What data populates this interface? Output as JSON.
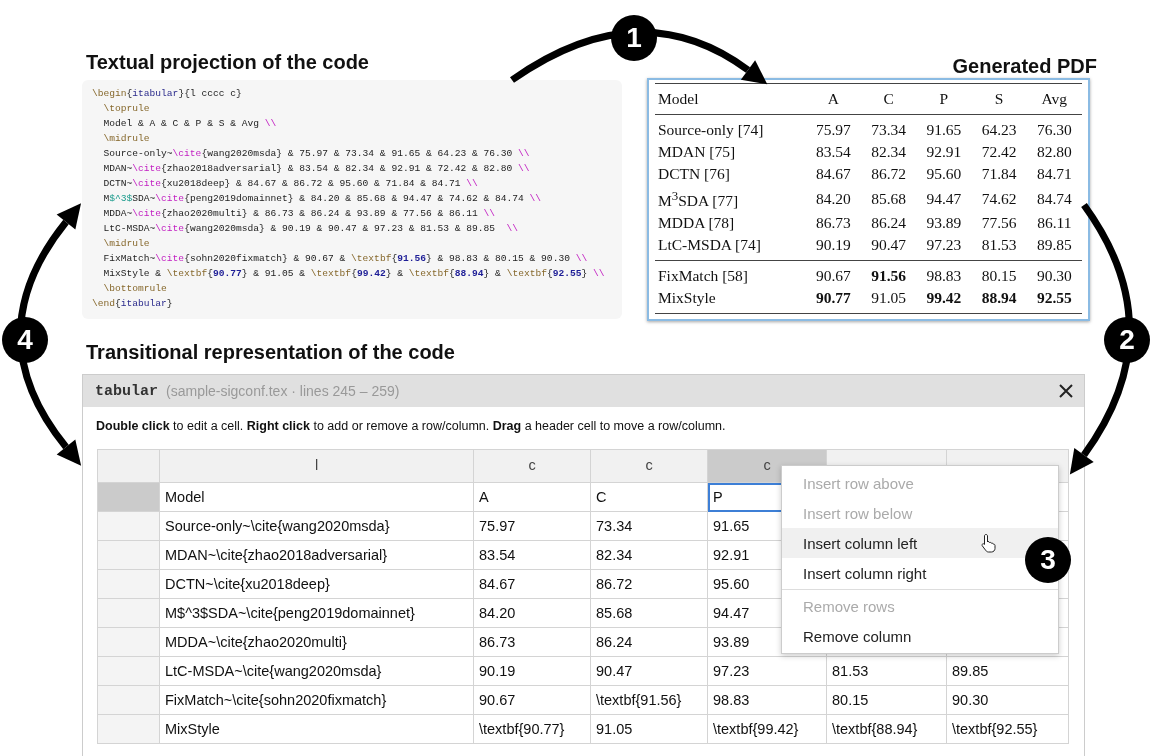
{
  "step_badges": [
    "1",
    "2",
    "3",
    "4"
  ],
  "code_view": {
    "title": "Textual projection of the code",
    "lines": [
      {
        "tokens": [
          {
            "kind": "command",
            "text": "\\begin"
          },
          {
            "kind": "plain",
            "text": "{"
          },
          {
            "kind": "arg",
            "text": "itabular"
          },
          {
            "kind": "plain",
            "text": "}{l cccc c}"
          }
        ],
        "children": [
          {
            "tokens": [
              {
                "kind": "command",
                "text": "\\toprule"
              }
            ]
          },
          {
            "tokens": [
              {
                "kind": "plain",
                "text": "Model & A & C & P & S & Avg "
              },
              {
                "kind": "linebreak",
                "text": "\\\\"
              }
            ]
          },
          {
            "tokens": [
              {
                "kind": "command",
                "text": "\\midrule"
              }
            ]
          },
          {
            "tokens": [
              {
                "kind": "plain",
                "text": "Source-only~"
              },
              {
                "kind": "cite",
                "text": "\\cite"
              },
              {
                "kind": "plain",
                "text": "{wang2020msda} & 75.97 & 73.34 & 91.65 & 64.23 & 76.30 "
              },
              {
                "kind": "linebreak",
                "text": "\\\\"
              }
            ]
          },
          {
            "tokens": [
              {
                "kind": "plain",
                "text": "MDAN~"
              },
              {
                "kind": "cite",
                "text": "\\cite"
              },
              {
                "kind": "plain",
                "text": "{zhao2018adversarial} & 83.54 & 82.34 & 92.91 & 72.42 & 82.80 "
              },
              {
                "kind": "linebreak",
                "text": "\\\\"
              }
            ]
          },
          {
            "tokens": [
              {
                "kind": "plain",
                "text": "DCTN~"
              },
              {
                "kind": "cite",
                "text": "\\cite"
              },
              {
                "kind": "plain",
                "text": "{xu2018deep} & 84.67 & 86.72 & 95.60 & 71.84 & 84.71 "
              },
              {
                "kind": "linebreak",
                "text": "\\\\"
              }
            ]
          },
          {
            "tokens": [
              {
                "kind": "plain",
                "text": "M"
              },
              {
                "kind": "math",
                "text": "$^3$"
              },
              {
                "kind": "plain",
                "text": "SDA~"
              },
              {
                "kind": "cite",
                "text": "\\cite"
              },
              {
                "kind": "plain",
                "text": "{peng2019domainnet} & 84.20 & 85.68 & 94.47 & 74.62 & 84.74 "
              },
              {
                "kind": "linebreak",
                "text": "\\\\"
              }
            ]
          },
          {
            "tokens": [
              {
                "kind": "plain",
                "text": "MDDA~"
              },
              {
                "kind": "cite",
                "text": "\\cite"
              },
              {
                "kind": "plain",
                "text": "{zhao2020multi} & 86.73 & 86.24 & 93.89 & 77.56 & 86.11 "
              },
              {
                "kind": "linebreak",
                "text": "\\\\"
              }
            ]
          },
          {
            "tokens": [
              {
                "kind": "plain",
                "text": "LtC-MSDA~"
              },
              {
                "kind": "cite",
                "text": "\\cite"
              },
              {
                "kind": "plain",
                "text": "{wang2020msda} & 90.19 & 90.47 & 97.23 & 81.53 & 89.85  "
              },
              {
                "kind": "linebreak",
                "text": "\\\\"
              }
            ]
          },
          {
            "tokens": [
              {
                "kind": "command",
                "text": "\\midrule"
              }
            ]
          },
          {
            "tokens": [
              {
                "kind": "plain",
                "text": "FixMatch~"
              },
              {
                "kind": "cite",
                "text": "\\cite"
              },
              {
                "kind": "plain",
                "text": "{sohn2020fixmatch} & 90.67 & "
              },
              {
                "kind": "command",
                "text": "\\textbf"
              },
              {
                "kind": "plain",
                "text": "{"
              },
              {
                "kind": "number",
                "text": "91.56"
              },
              {
                "kind": "plain",
                "text": "} & 98.83 & 80.15 & 90.30 "
              },
              {
                "kind": "linebreak",
                "text": "\\\\"
              }
            ]
          },
          {
            "tokens": [
              {
                "kind": "plain",
                "text": "MixStyle & "
              },
              {
                "kind": "command",
                "text": "\\textbf"
              },
              {
                "kind": "plain",
                "text": "{"
              },
              {
                "kind": "number",
                "text": "90.77"
              },
              {
                "kind": "plain",
                "text": "} & 91.05 & "
              },
              {
                "kind": "command",
                "text": "\\textbf"
              },
              {
                "kind": "plain",
                "text": "{"
              },
              {
                "kind": "number",
                "text": "99.42"
              },
              {
                "kind": "plain",
                "text": "} & "
              },
              {
                "kind": "command",
                "text": "\\textbf"
              },
              {
                "kind": "plain",
                "text": "{"
              },
              {
                "kind": "number",
                "text": "88.94"
              },
              {
                "kind": "plain",
                "text": "} & "
              },
              {
                "kind": "command",
                "text": "\\textbf"
              },
              {
                "kind": "plain",
                "text": "{"
              },
              {
                "kind": "number",
                "text": "92.55"
              },
              {
                "kind": "plain",
                "text": "} "
              },
              {
                "kind": "linebreak",
                "text": "\\\\"
              }
            ]
          },
          {
            "tokens": [
              {
                "kind": "command",
                "text": "\\bottomrule"
              }
            ]
          }
        ]
      },
      {
        "tokens": [
          {
            "kind": "command",
            "text": "\\end"
          },
          {
            "kind": "plain",
            "text": "{"
          },
          {
            "kind": "arg",
            "text": "itabular"
          },
          {
            "kind": "plain",
            "text": "}"
          }
        ]
      }
    ]
  },
  "pdf_view": {
    "title": "Generated PDF",
    "header": [
      "Model",
      "A",
      "C",
      "P",
      "S",
      "Avg"
    ],
    "sections": [
      [
        {
          "cells": [
            {
              "text": "Source-only [74]",
              "bold": false
            },
            {
              "text": "75.97",
              "bold": false
            },
            {
              "text": "73.34",
              "bold": false
            },
            {
              "text": "91.65",
              "bold": false
            },
            {
              "text": "64.23",
              "bold": false
            },
            {
              "text": "76.30",
              "bold": false
            }
          ]
        },
        {
          "cells": [
            {
              "text": "MDAN [75]",
              "bold": false
            },
            {
              "text": "83.54",
              "bold": false
            },
            {
              "text": "82.34",
              "bold": false
            },
            {
              "text": "92.91",
              "bold": false
            },
            {
              "text": "72.42",
              "bold": false
            },
            {
              "text": "82.80",
              "bold": false
            }
          ]
        },
        {
          "cells": [
            {
              "text": "DCTN [76]",
              "bold": false
            },
            {
              "text": "84.67",
              "bold": false
            },
            {
              "text": "86.72",
              "bold": false
            },
            {
              "text": "95.60",
              "bold": false
            },
            {
              "text": "71.84",
              "bold": false
            },
            {
              "text": "84.71",
              "bold": false
            }
          ]
        },
        {
          "cells": [
            {
              "text": "M$^{3}$SDA [77]",
              "bold": false
            },
            {
              "text": "84.20",
              "bold": false
            },
            {
              "text": "85.68",
              "bold": false
            },
            {
              "text": "94.47",
              "bold": false
            },
            {
              "text": "74.62",
              "bold": false
            },
            {
              "text": "84.74",
              "bold": false
            }
          ]
        },
        {
          "cells": [
            {
              "text": "MDDA [78]",
              "bold": false
            },
            {
              "text": "86.73",
              "bold": false
            },
            {
              "text": "86.24",
              "bold": false
            },
            {
              "text": "93.89",
              "bold": false
            },
            {
              "text": "77.56",
              "bold": false
            },
            {
              "text": "86.11",
              "bold": false
            }
          ]
        },
        {
          "cells": [
            {
              "text": "LtC-MSDA [74]",
              "bold": false
            },
            {
              "text": "90.19",
              "bold": false
            },
            {
              "text": "90.47",
              "bold": false
            },
            {
              "text": "97.23",
              "bold": false
            },
            {
              "text": "81.53",
              "bold": false
            },
            {
              "text": "89.85",
              "bold": false
            }
          ]
        }
      ],
      [
        {
          "cells": [
            {
              "text": "FixMatch [58]",
              "bold": false
            },
            {
              "text": "90.67",
              "bold": false
            },
            {
              "text": "91.56",
              "bold": true
            },
            {
              "text": "98.83",
              "bold": false
            },
            {
              "text": "80.15",
              "bold": false
            },
            {
              "text": "90.30",
              "bold": false
            }
          ]
        },
        {
          "cells": [
            {
              "text": "MixStyle",
              "bold": false
            },
            {
              "text": "90.77",
              "bold": true
            },
            {
              "text": "91.05",
              "bold": false
            },
            {
              "text": "99.42",
              "bold": true
            },
            {
              "text": "88.94",
              "bold": true
            },
            {
              "text": "92.55",
              "bold": true
            }
          ]
        }
      ]
    ]
  },
  "table_editor": {
    "heading": "Transitional representation of the code",
    "title_bar": {
      "element": "tabular",
      "source": "(sample-sigconf.tex · lines 245 – 259)"
    },
    "hint": "**Double click** to edit a cell. **Right click** to add or remove a row/column. **Drag** a header cell to move a row/column.",
    "columns": [
      {
        "label": "l",
        "selected": false
      },
      {
        "label": "c",
        "selected": false
      },
      {
        "label": "c",
        "selected": false
      },
      {
        "label": "c",
        "selected": true
      },
      {
        "selected": false
      },
      {
        "selected": false
      }
    ],
    "rows": [
      {
        "selected": true,
        "cells": [
          "Model",
          "A",
          "C",
          "P"
        ]
      },
      {
        "selected": false,
        "cells": [
          "Source-only~\\cite{wang2020msda}",
          "75.97",
          "73.34",
          "91.65"
        ]
      },
      {
        "selected": false,
        "cells": [
          "MDAN~\\cite{zhao2018adversarial}",
          "83.54",
          "82.34",
          "92.91"
        ]
      },
      {
        "selected": false,
        "cells": [
          "DCTN~\\cite{xu2018deep}",
          "84.67",
          "86.72",
          "95.60"
        ]
      },
      {
        "selected": false,
        "cells": [
          "M$^3$SDA~\\cite{peng2019domainnet}",
          "84.20",
          "85.68",
          "94.47"
        ]
      },
      {
        "selected": false,
        "cells": [
          "MDDA~\\cite{zhao2020multi}",
          "86.73",
          "86.24",
          "93.89"
        ]
      },
      {
        "selected": false,
        "cells": [
          "LtC-MSDA~\\cite{wang2020msda}",
          "90.19",
          "90.47",
          "97.23",
          "81.53",
          "89.85"
        ]
      },
      {
        "selected": false,
        "cells": [
          "FixMatch~\\cite{sohn2020fixmatch}",
          "90.67",
          "\\textbf{91.56}",
          "98.83",
          "80.15",
          "90.30"
        ]
      },
      {
        "selected": false,
        "cells": [
          "MixStyle",
          "\\textbf{90.77}",
          "91.05",
          "\\textbf{99.42}",
          "\\textbf{88.94}",
          "\\textbf{92.55}"
        ]
      }
    ],
    "context_menu": [
      {
        "kind": "item",
        "label": "Insert row above",
        "disabled": true,
        "highlighted": false
      },
      {
        "kind": "item",
        "label": "Insert row below",
        "disabled": true,
        "highlighted": false
      },
      {
        "kind": "item",
        "label": "Insert column left",
        "disabled": false,
        "highlighted": true
      },
      {
        "kind": "item",
        "label": "Insert column right",
        "disabled": false,
        "highlighted": false
      },
      {
        "kind": "separator"
      },
      {
        "kind": "item",
        "label": "Remove rows",
        "disabled": true,
        "highlighted": false
      },
      {
        "kind": "item",
        "label": "Remove column",
        "disabled": false,
        "highlighted": false
      }
    ]
  }
}
